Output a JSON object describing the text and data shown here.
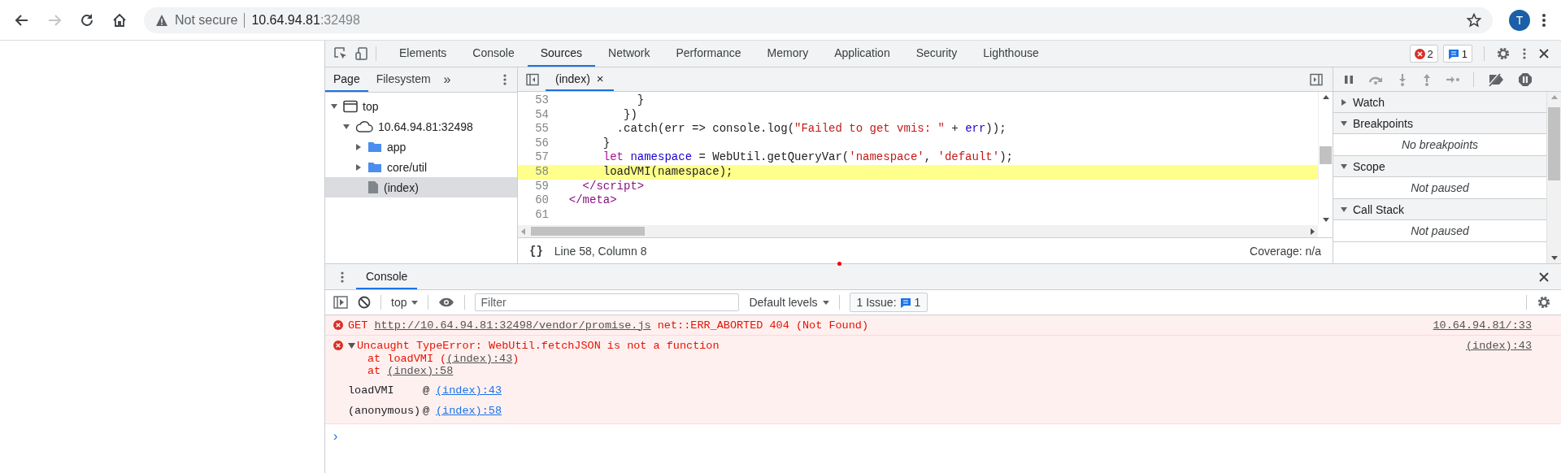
{
  "browser": {
    "nav_buttons": [
      {
        "kind": "back",
        "disabled": false
      },
      {
        "kind": "forward",
        "disabled": true
      },
      {
        "kind": "reload",
        "disabled": false
      },
      {
        "kind": "home",
        "disabled": false
      }
    ],
    "address": {
      "security": "Not secure",
      "host": "10.64.94.81",
      "port": ":32498"
    },
    "avatar": "T"
  },
  "devtools": {
    "tabs": [
      {
        "label": "Elements",
        "selected": false
      },
      {
        "label": "Console",
        "selected": false
      },
      {
        "label": "Sources",
        "selected": true
      },
      {
        "label": "Network",
        "selected": false
      },
      {
        "label": "Performance",
        "selected": false
      },
      {
        "label": "Memory",
        "selected": false
      },
      {
        "label": "Application",
        "selected": false
      },
      {
        "label": "Security",
        "selected": false
      },
      {
        "label": "Lighthouse",
        "selected": false
      }
    ],
    "error_count": "2",
    "message_count": "1"
  },
  "sources": {
    "navigator": {
      "tabs": [
        {
          "label": "Page",
          "selected": true
        },
        {
          "label": "Filesystem",
          "selected": false
        }
      ],
      "more": "»",
      "tree": [
        {
          "label": "top",
          "kind": "frame",
          "expanded": true,
          "selected": false,
          "children": [
            {
              "label": "10.64.94.81:32498",
              "kind": "origin",
              "expanded": true,
              "selected": false,
              "children": [
                {
                  "label": "app",
                  "kind": "folder",
                  "expanded": false,
                  "selected": false
                },
                {
                  "label": "core/util",
                  "kind": "folder",
                  "expanded": false,
                  "selected": false
                },
                {
                  "label": "(index)",
                  "kind": "file",
                  "selected": true
                }
              ]
            }
          ]
        }
      ]
    },
    "editor": {
      "file_tab": {
        "label": "(index)",
        "close": "×"
      },
      "lines": [
        {
          "number": "53",
          "highlighted": false,
          "tokens": [
            {
              "kind": "plain",
              "text": "            }"
            }
          ]
        },
        {
          "number": "54",
          "highlighted": false,
          "tokens": [
            {
              "kind": "plain",
              "text": "          })"
            }
          ]
        },
        {
          "number": "55",
          "highlighted": false,
          "tokens": [
            {
              "kind": "plain",
              "text": "         .catch(err => console.log("
            },
            {
              "kind": "string",
              "text": "\"Failed to get vmis: \""
            },
            {
              "kind": "plain",
              "text": " + "
            },
            {
              "kind": "variable",
              "text": "err"
            },
            {
              "kind": "plain",
              "text": "));"
            }
          ]
        },
        {
          "number": "56",
          "highlighted": false,
          "tokens": [
            {
              "kind": "plain",
              "text": "       }"
            }
          ]
        },
        {
          "number": "57",
          "highlighted": false,
          "tokens": [
            {
              "kind": "keyword",
              "text": "       let"
            },
            {
              "kind": "variable",
              "text": " namespace"
            },
            {
              "kind": "plain",
              "text": " = WebUtil.getQueryVar("
            },
            {
              "kind": "string",
              "text": "'namespace'"
            },
            {
              "kind": "plain",
              "text": ", "
            },
            {
              "kind": "string",
              "text": "'default'"
            },
            {
              "kind": "plain",
              "text": ");"
            }
          ]
        },
        {
          "number": "58",
          "highlighted": true,
          "tokens": [
            {
              "kind": "plain",
              "text": "       loadVMI(namespace);"
            }
          ]
        },
        {
          "number": "59",
          "highlighted": false,
          "tokens": [
            {
              "kind": "tag",
              "text": "    </script>"
            }
          ]
        },
        {
          "number": "60",
          "highlighted": false,
          "tokens": [
            {
              "kind": "tag",
              "text": "  </meta>"
            }
          ]
        },
        {
          "number": "61",
          "highlighted": false
        }
      ],
      "status": {
        "format": "{}",
        "position": "Line 58, Column 8",
        "coverage": "Coverage: n/a"
      }
    },
    "debugger": {
      "controls": [
        {
          "kind": "pause",
          "disabled": false
        },
        {
          "kind": "step-over",
          "disabled": true
        },
        {
          "kind": "step-into",
          "disabled": true
        },
        {
          "kind": "step-out",
          "disabled": true
        },
        {
          "kind": "step",
          "disabled": true
        },
        {
          "kind": "deactivate",
          "disabled": false
        },
        {
          "kind": "pause-exceptions",
          "disabled": false
        }
      ],
      "sections": [
        {
          "title": "Watch",
          "expanded": false
        },
        {
          "title": "Breakpoints",
          "expanded": true,
          "body": "No breakpoints"
        },
        {
          "title": "Scope",
          "expanded": true,
          "body": "Not paused"
        },
        {
          "title": "Call Stack",
          "expanded": true,
          "body": "Not paused"
        }
      ]
    }
  },
  "drawer": {
    "tabs": [
      {
        "label": "Console",
        "selected": true
      }
    ],
    "toolbar": {
      "context": "top",
      "filter_placeholder": "Filter",
      "levels": "Default levels",
      "issues_label": "1 Issue:",
      "issues_count": "1"
    },
    "messages": [
      {
        "kind": "request",
        "parts": [
          {
            "text": "GET ",
            "link": false
          },
          {
            "text": "http://10.64.94.81:32498/vendor/promise.js",
            "link": true
          },
          {
            "text": " net::ERR_ABORTED 404 (Not Found)",
            "link": false
          }
        ],
        "source": "10.64.94.81/:33"
      },
      {
        "kind": "exception",
        "expanded": true,
        "title": "Uncaught TypeError: WebUtil.fetchJSON is not a function",
        "source": "(index):43",
        "stack": [
          [
            {
              "text": "at loadVMI (",
              "link": false
            },
            {
              "text": "(index):43",
              "link": true
            },
            {
              "text": ")",
              "link": false
            }
          ],
          [
            {
              "text": "at ",
              "link": false
            },
            {
              "text": "(index):58",
              "link": true
            }
          ]
        ],
        "frames": [
          {
            "function": "loadVMI",
            "at": "@",
            "location": "(index):43"
          },
          {
            "function": "(anonymous)",
            "at": "@",
            "location": "(index):58"
          }
        ]
      }
    ],
    "prompt": "›"
  }
}
